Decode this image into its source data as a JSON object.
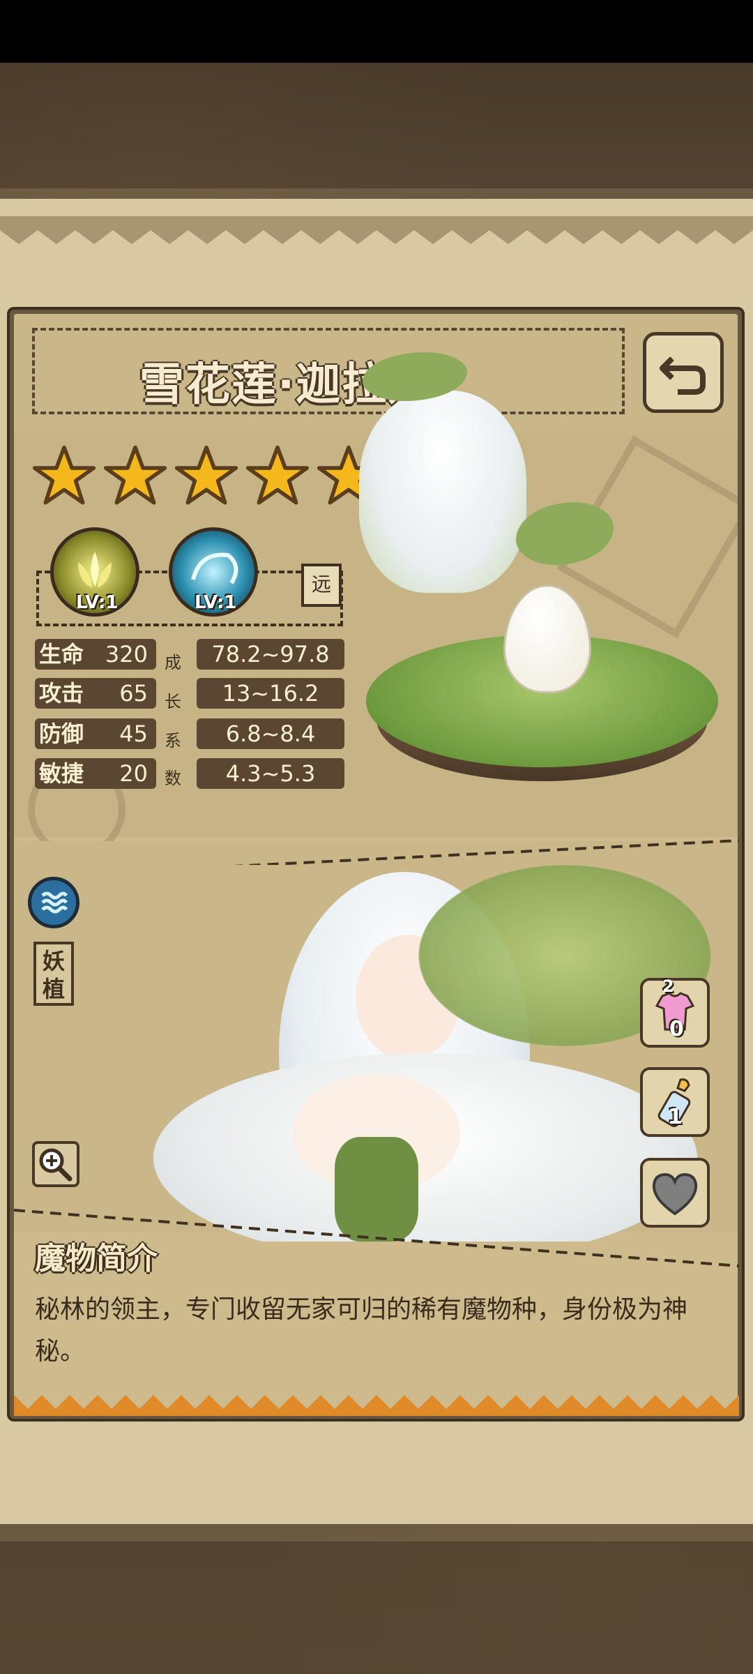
{
  "monster": {
    "name": "雪花莲·迦拉娅",
    "star_count": 5,
    "range_tag": "远",
    "race_tag": "妖植"
  },
  "skills": [
    {
      "level": "LV:1",
      "icon": "golden-lotus-icon"
    },
    {
      "level": "LV:1",
      "icon": "blue-swirl-icon"
    }
  ],
  "growth_label": [
    "成",
    "长",
    "系",
    "数"
  ],
  "stats": [
    {
      "label": "生命",
      "value": "320",
      "growth": "78.2~97.8"
    },
    {
      "label": "攻击",
      "value": "65",
      "growth": "13~16.2"
    },
    {
      "label": "防御",
      "value": "45",
      "growth": "6.8~8.4"
    },
    {
      "label": "敏捷",
      "value": "20",
      "growth": "4.3~5.3"
    }
  ],
  "side_buttons": [
    {
      "icon": "outfit-icon",
      "count": "0",
      "top_count": "2"
    },
    {
      "icon": "baby-bottle-icon",
      "count": "1"
    },
    {
      "icon": "heart-icon"
    }
  ],
  "description": {
    "title": "魔物简介",
    "text": "秘林的领主，专门收留无家可归的稀有魔物种，身份极为神秘。"
  },
  "colors": {
    "parchment": "#d9c9a0",
    "panel_border": "#4a3826",
    "stat_box": "#5a4631",
    "star": "#f4b81c"
  }
}
